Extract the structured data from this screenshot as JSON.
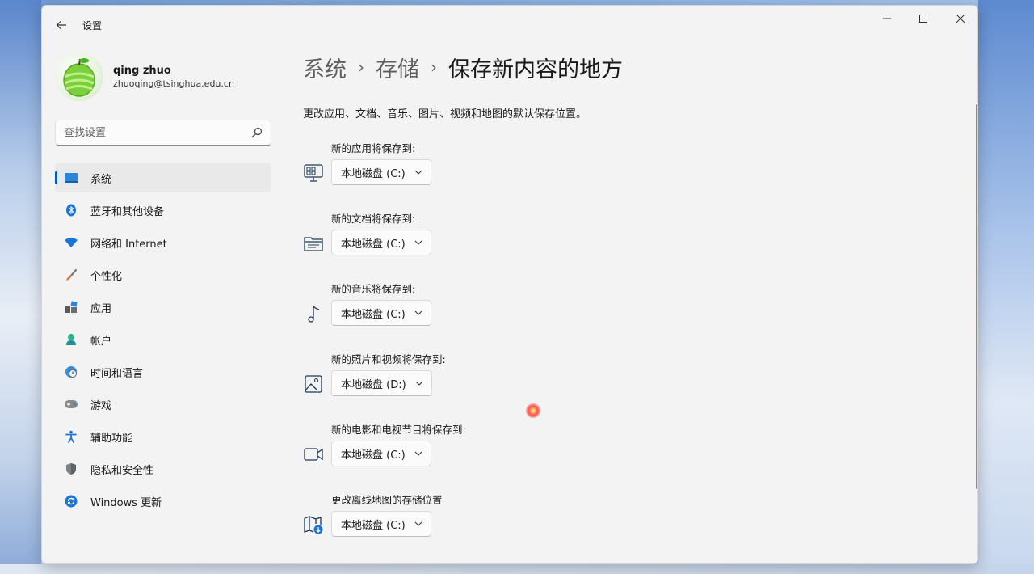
{
  "window": {
    "title": "设置"
  },
  "profile": {
    "name": "qing zhuo",
    "email": "zhuoqing@tsinghua.edu.cn"
  },
  "search": {
    "placeholder": "查找设置"
  },
  "nav": {
    "items": [
      {
        "label": "系统",
        "icon": "system-icon",
        "active": true
      },
      {
        "label": "蓝牙和其他设备",
        "icon": "bluetooth-icon"
      },
      {
        "label": "网络和 Internet",
        "icon": "wifi-icon"
      },
      {
        "label": "个性化",
        "icon": "brush-icon"
      },
      {
        "label": "应用",
        "icon": "apps-icon"
      },
      {
        "label": "帐户",
        "icon": "account-icon"
      },
      {
        "label": "时间和语言",
        "icon": "globe-clock-icon"
      },
      {
        "label": "游戏",
        "icon": "gamepad-icon"
      },
      {
        "label": "辅助功能",
        "icon": "accessibility-icon"
      },
      {
        "label": "隐私和安全性",
        "icon": "shield-icon"
      },
      {
        "label": "Windows 更新",
        "icon": "update-icon"
      }
    ]
  },
  "breadcrumb": {
    "items": [
      "系统",
      "存储",
      "保存新内容的地方"
    ]
  },
  "content": {
    "description": "更改应用、文档、音乐、图片、视频和地图的默认保存位置。",
    "settings": [
      {
        "label": "新的应用将保存到:",
        "value": "本地磁盘 (C:)",
        "icon": "apps-monitor-icon"
      },
      {
        "label": "新的文档将保存到:",
        "value": "本地磁盘 (C:)",
        "icon": "folder-icon"
      },
      {
        "label": "新的音乐将保存到:",
        "value": "本地磁盘 (C:)",
        "icon": "music-note-icon"
      },
      {
        "label": "新的照片和视频将保存到:",
        "value": "本地磁盘 (D:)",
        "icon": "picture-icon"
      },
      {
        "label": "新的电影和电视节目将保存到:",
        "value": "本地磁盘 (C:)",
        "icon": "video-camera-icon"
      },
      {
        "label": "更改离线地图的存储位置",
        "value": "本地磁盘 (C:)",
        "icon": "map-download-icon"
      }
    ]
  },
  "colors": {
    "accent": "#005fb8",
    "window_bg": "#f3f3f3"
  }
}
